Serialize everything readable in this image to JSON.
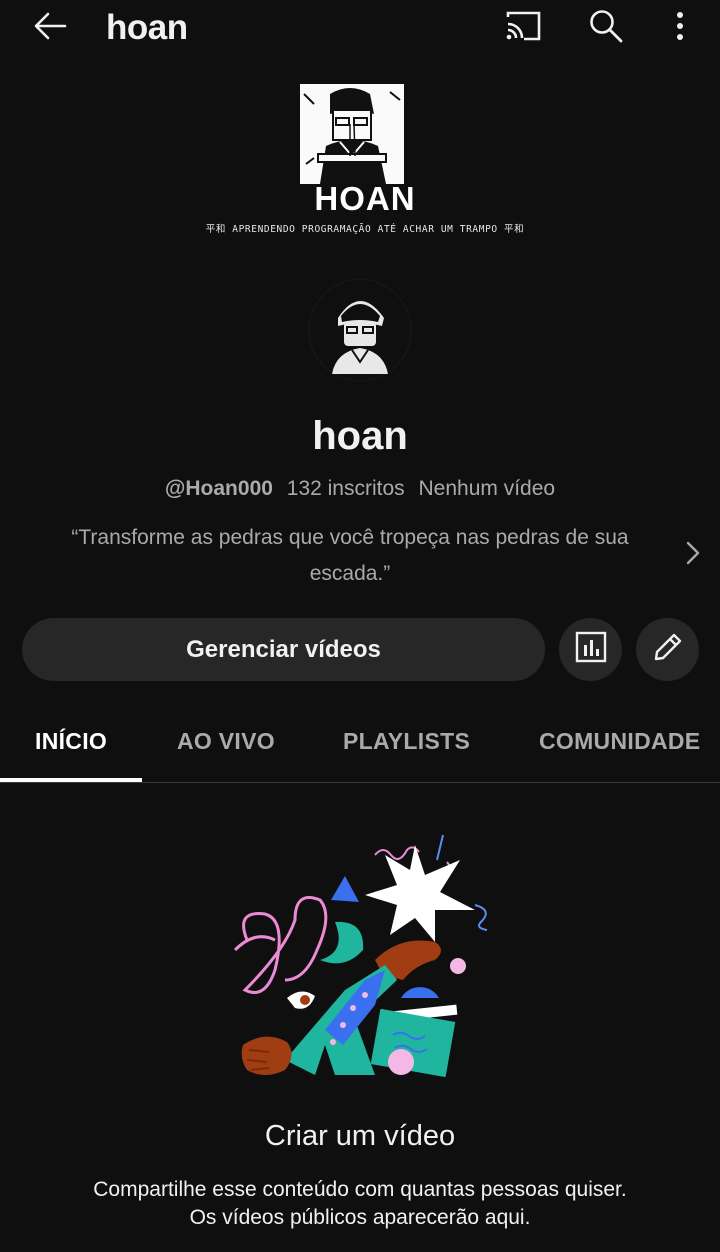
{
  "header": {
    "title": "hoan",
    "icons": [
      "back-arrow-icon",
      "cast-icon",
      "search-icon",
      "more-vert-icon"
    ]
  },
  "banner": {
    "name": "HOAN",
    "tagline": "平和 APRENDENDO PROGRAMAÇÃO ATÉ ACHAR UM TRAMPO 平和"
  },
  "channel": {
    "name": "hoan",
    "handle": "@Hoan000",
    "subscribers": "132 inscritos",
    "videos": "Nenhum vídeo",
    "description": "“Transforme as pedras que você tropeça nas pedras de sua escada.”"
  },
  "actions": {
    "manage_label": "Gerenciar vídeos",
    "stats_icon": "analytics-icon",
    "edit_icon": "pencil-icon"
  },
  "tabs": [
    {
      "label": "INÍCIO",
      "active": true
    },
    {
      "label": "AO VIVO",
      "active": false
    },
    {
      "label": "PLAYLISTS",
      "active": false
    },
    {
      "label": "COMUNIDADE",
      "active": false
    }
  ],
  "empty_state": {
    "title": "Criar um vídeo",
    "line1": "Compartilhe esse conteúdo com quantas pessoas quiser.",
    "line2": "Os vídeos públicos aparecerão aqui."
  },
  "colors": {
    "background": "#0f0f0f",
    "button_bg": "#272727",
    "text_secondary": "#aaaaaa"
  }
}
